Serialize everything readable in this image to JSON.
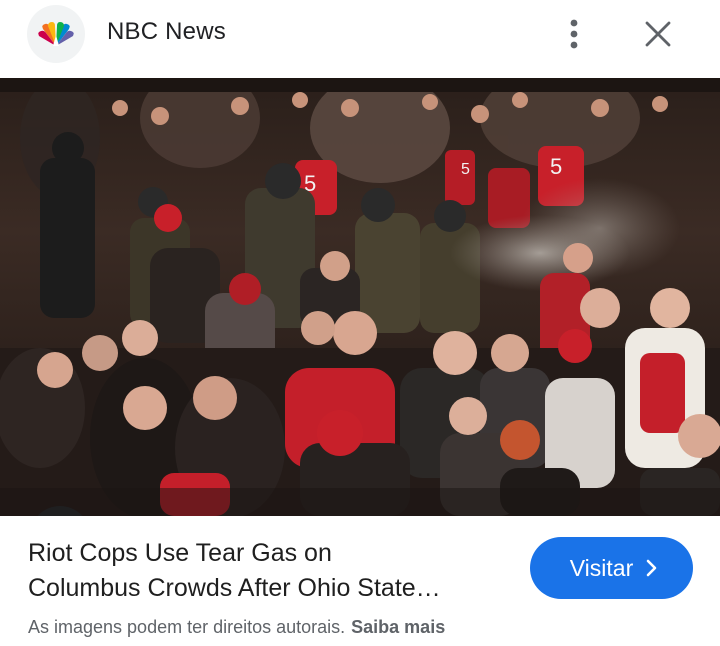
{
  "header": {
    "site_name": "NBC News",
    "logo_icon": "nbc-peacock-logo",
    "more_icon": "more-vert-icon",
    "close_icon": "close-icon"
  },
  "image": {
    "description_icon": "lens-icon",
    "jersey_numbers": [
      "5",
      "5",
      "5"
    ]
  },
  "result": {
    "title_line1": "Riot Cops Use Tear Gas on",
    "title_line2": "Columbus Crowds After Ohio State…",
    "visit_label": "Visitar",
    "visit_icon": "chevron-right-icon",
    "copyright_text": "As imagens podem ter direitos autorais.",
    "learn_more": "Saiba mais"
  },
  "colors": {
    "accent": "#1a73e8",
    "text_primary": "#1f1f1f",
    "text_secondary": "#5f6368"
  }
}
